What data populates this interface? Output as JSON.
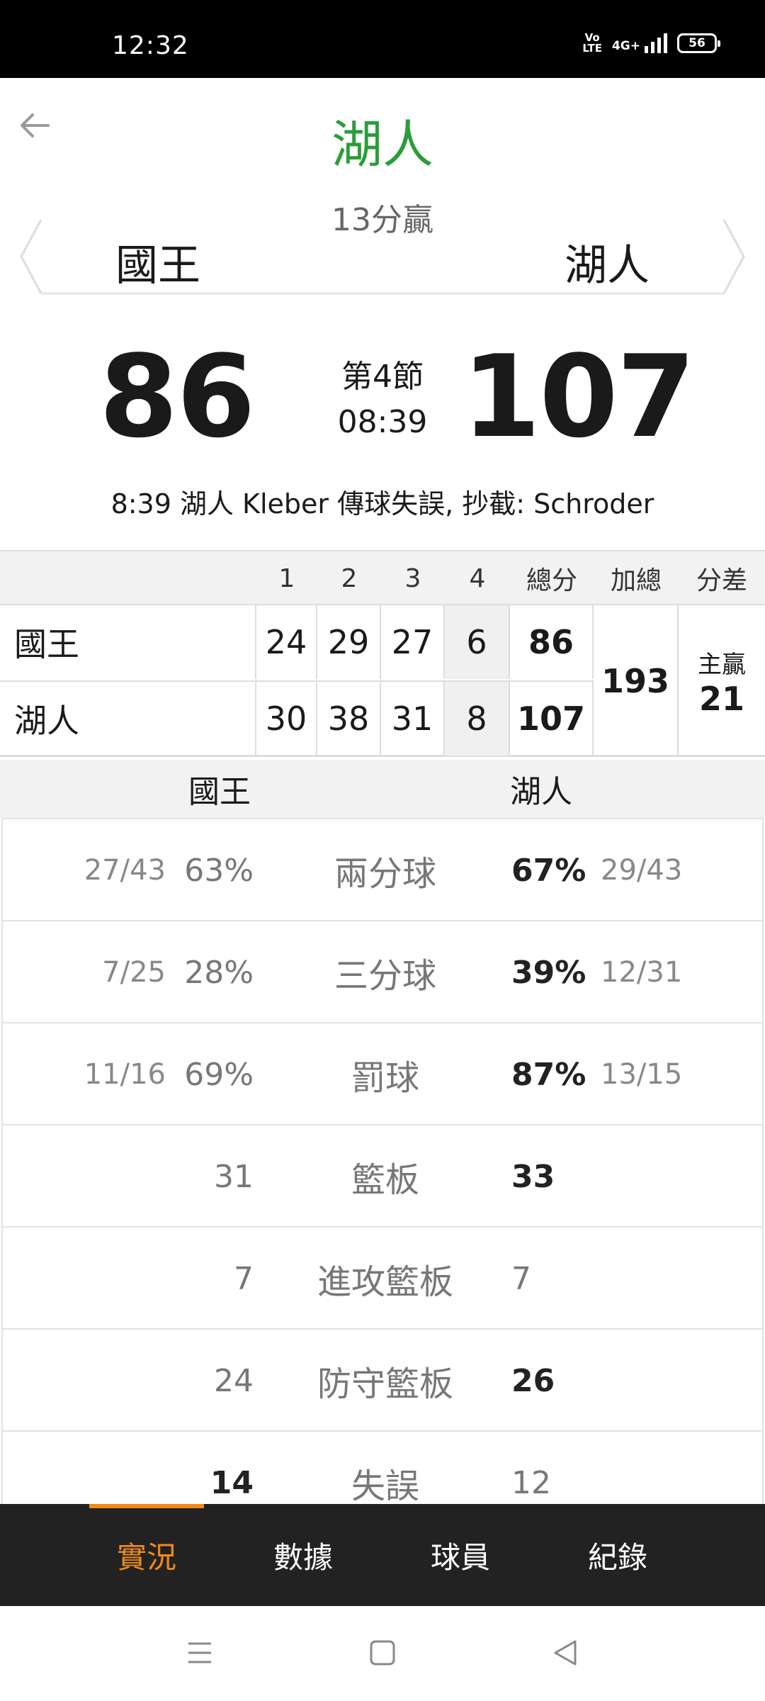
{
  "status": {
    "time": "12:32",
    "battery": "56",
    "volte": "Vo\nLTE",
    "network": "4G+"
  },
  "header": {
    "winner": "湖人",
    "win_by": "13分贏",
    "away": "國王",
    "home": "湖人"
  },
  "score": {
    "away": "86",
    "home": "107",
    "period": "第4節",
    "clock": "08:39"
  },
  "last_play": "8:39 湖人 Kleber 傳球失誤, 抄截: Schroder",
  "quarters": {
    "headers": [
      "1",
      "2",
      "3",
      "4",
      "總分",
      "加總",
      "分差"
    ],
    "rows": [
      {
        "team": "國王",
        "q": [
          "24",
          "29",
          "27",
          "6"
        ],
        "total": "86"
      },
      {
        "team": "湖人",
        "q": [
          "30",
          "38",
          "31",
          "8"
        ],
        "total": "107"
      }
    ],
    "sum": "193",
    "diff_label": "主贏",
    "diff": "21"
  },
  "team_stats": {
    "away_label": "國王",
    "home_label": "湖人",
    "rows": [
      {
        "label": "兩分球",
        "away_frac": "27/43",
        "away": "63%",
        "home": "67%",
        "home_frac": "29/43",
        "leader": "home"
      },
      {
        "label": "三分球",
        "away_frac": "7/25",
        "away": "28%",
        "home": "39%",
        "home_frac": "12/31",
        "leader": "home"
      },
      {
        "label": "罰球",
        "away_frac": "11/16",
        "away": "69%",
        "home": "87%",
        "home_frac": "13/15",
        "leader": "home"
      },
      {
        "label": "籃板",
        "away_frac": "",
        "away": "31",
        "home": "33",
        "home_frac": "",
        "leader": "home"
      },
      {
        "label": "進攻籃板",
        "away_frac": "",
        "away": "7",
        "home": "7",
        "home_frac": "",
        "leader": "none"
      },
      {
        "label": "防守籃板",
        "away_frac": "",
        "away": "24",
        "home": "26",
        "home_frac": "",
        "leader": "home"
      },
      {
        "label": "失誤",
        "away_frac": "",
        "away": "14",
        "home": "12",
        "home_frac": "",
        "leader": "away"
      }
    ]
  },
  "tabs": [
    "實況",
    "數據",
    "球員",
    "紀錄"
  ],
  "active_tab": 0,
  "colors": {
    "winner": "#2a9d3a",
    "accent": "#f08a1c",
    "tabbar": "#222222"
  }
}
